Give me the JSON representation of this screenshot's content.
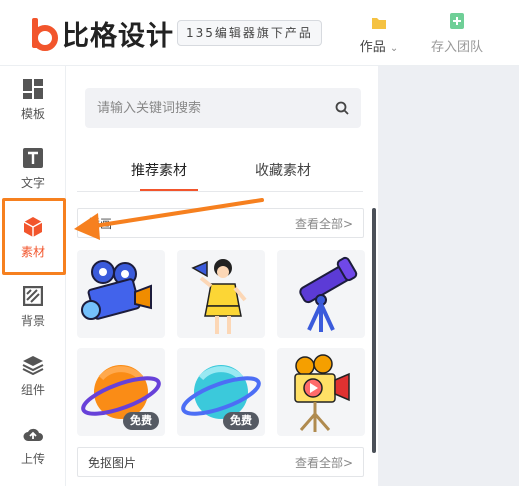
{
  "header": {
    "logo_text": "比格设计",
    "badge": "135编辑器旗下产品",
    "works_label": "作品",
    "team_label": "存入团队"
  },
  "rail": {
    "items": [
      {
        "label": "模板",
        "icon": "template-icon"
      },
      {
        "label": "文字",
        "icon": "text-icon"
      },
      {
        "label": "素材",
        "icon": "material-cube-icon",
        "active": true
      },
      {
        "label": "背景",
        "icon": "background-icon"
      },
      {
        "label": "组件",
        "icon": "component-layers-icon"
      },
      {
        "label": "上传",
        "icon": "upload-cloud-icon"
      }
    ]
  },
  "panel": {
    "search_placeholder": "请输入关键词搜索",
    "tabs": [
      {
        "label": "推荐素材",
        "active": true
      },
      {
        "label": "收藏素材",
        "active": false
      }
    ],
    "sections": [
      {
        "title": "插画",
        "more": "查看全部>"
      },
      {
        "title": "免抠图片",
        "more": "查看全部>"
      }
    ],
    "tiles": [
      {
        "name": "film-camera-illustration"
      },
      {
        "name": "girl-megaphone-illustration"
      },
      {
        "name": "telescope-illustration"
      },
      {
        "name": "orange-planet-image",
        "badge": "免费"
      },
      {
        "name": "blue-planet-image",
        "badge": "免费"
      },
      {
        "name": "video-camera-image"
      }
    ]
  },
  "colors": {
    "accent": "#f2552c",
    "highlight_box": "#f6801f",
    "canvas_bg": "#edeff3"
  }
}
